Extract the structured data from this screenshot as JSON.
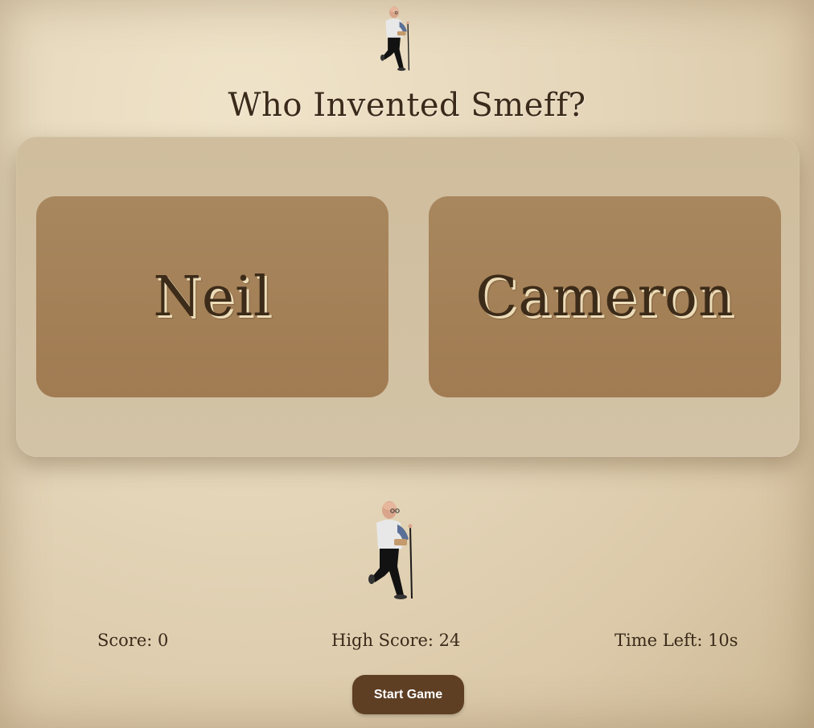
{
  "game": {
    "question": "Who Invented Smeff?",
    "options": [
      {
        "label": "Neil"
      },
      {
        "label": "Cameron"
      }
    ]
  },
  "stats": {
    "score_text": "Score: 0",
    "high_score_text": "High Score: 24",
    "time_left_text": "Time Left: 10s"
  },
  "controls": {
    "start_label": "Start Game"
  },
  "colors": {
    "background": "#e6d7bb",
    "panel": "#d1bfa1",
    "option_card": "#a5825a",
    "text": "#3b2a1a",
    "button": "#5e3f24",
    "button_text": "#ffffff"
  }
}
